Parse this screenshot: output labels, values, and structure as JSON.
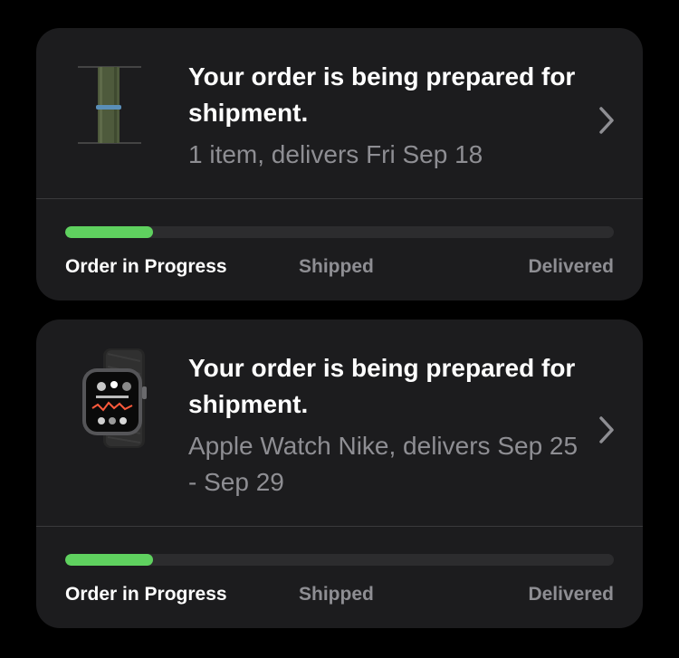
{
  "colors": {
    "background": "#000000",
    "card": "#1c1c1e",
    "progress_fill": "#5fd15f",
    "progress_track": "#2c2c2e",
    "primary_text": "#ffffff",
    "secondary_text": "#8e8e93"
  },
  "orders": [
    {
      "thumbnail": "sport-loop-band-image",
      "status_title": "Your order is being prepared for shipment.",
      "details": "1 item, delivers Fri Sep 18",
      "progress": 0.16,
      "steps": [
        "Order in Progress",
        "Shipped",
        "Delivered"
      ],
      "chevron_icon": "chevron-right-icon"
    },
    {
      "thumbnail": "apple-watch-nike-image",
      "status_title": "Your order is being prepared for shipment.",
      "details": "Apple Watch Nike, delivers Sep 25 - Sep 29",
      "progress": 0.16,
      "steps": [
        "Order in Progress",
        "Shipped",
        "Delivered"
      ],
      "chevron_icon": "chevron-right-icon"
    }
  ]
}
